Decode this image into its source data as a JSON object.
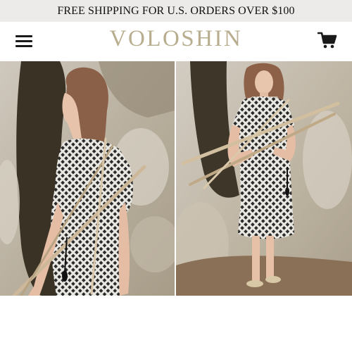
{
  "promo": {
    "text": "FREE SHIPPING FOR U.S. ORDERS OVER $100"
  },
  "header": {
    "logo": "VOLOSHIN",
    "menu_icon": "hamburger-menu-icon",
    "cart_icon": "shopping-cart-icon"
  },
  "colors": {
    "promo_bg": "#ecebe9",
    "logo": "#b8ad8f",
    "text": "#111111"
  },
  "gallery": {
    "images": [
      {
        "subject": "model in black and white patterned dress holding branches, back view"
      },
      {
        "subject": "model in black and white patterned wrap dress holding branches, front view"
      }
    ]
  }
}
